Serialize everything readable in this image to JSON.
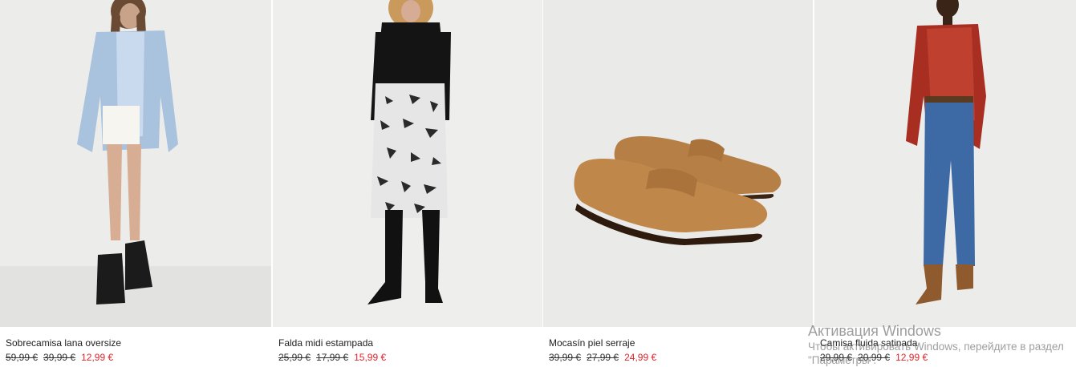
{
  "products": [
    {
      "name": "Sobrecamisa lana oversize",
      "prices": [
        "59,99 €",
        "39,99 €"
      ],
      "sale": "12,99 €",
      "image": "oversize-wool-overshirt-photo"
    },
    {
      "name": "Falda midi estampada",
      "prices": [
        "25,99 €",
        "17,99 €"
      ],
      "sale": "15,99 €",
      "image": "printed-midi-skirt-photo"
    },
    {
      "name": "Mocasín piel serraje",
      "prices": [
        "39,99 €",
        "27,99 €"
      ],
      "sale": "24,99 €",
      "image": "suede-loafers-photo"
    },
    {
      "name": "Camisa fluida satinada",
      "prices": [
        "29,99 €",
        "20,99 €"
      ],
      "sale": "12,99 €",
      "image": "satin-shirt-photo"
    }
  ],
  "watermark": {
    "title": "Активация Windows",
    "text": "Чтобы активировать Windows, перейдите в раздел \"Параметры\"."
  },
  "colors": {
    "sale": "#e0262b",
    "watermark": "#787878"
  }
}
